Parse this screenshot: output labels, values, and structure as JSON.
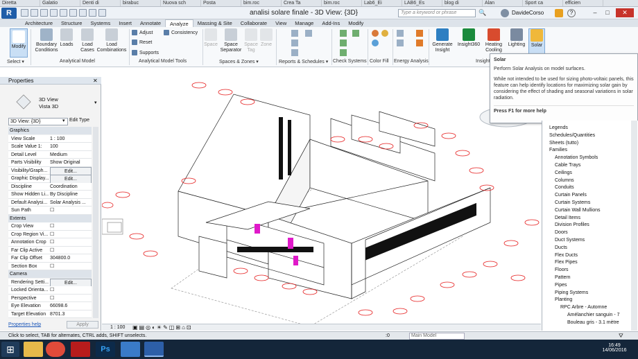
{
  "browser_tabs": [
    "Diretta",
    "Galatio",
    "Denti di",
    "birabuc",
    "Nuova sch",
    "Posta",
    "bim.roc",
    "Crea Ta",
    "bim.roc",
    "Lab6_Ei",
    "LAB6_Es",
    "blog di",
    "Alan",
    "Sport ca",
    "efficien"
  ],
  "window": {
    "title": "analisi solare finale - 3D View: {3D}",
    "search_placeholder": "Type a keyword or phrase",
    "user": "DavideCorso",
    "min": "–",
    "max": "□",
    "close": "✕"
  },
  "menu_tabs": [
    "Architecture",
    "Structure",
    "Systems",
    "Insert",
    "Annotate",
    "Analyze",
    "Massing & Site",
    "Collaborate",
    "View",
    "Manage",
    "Add-Ins",
    "Modify"
  ],
  "active_tab": "Analyze",
  "ribbon": {
    "modify": "Modify",
    "boundary_conditions": "Boundary\nConditions",
    "loads": "Loads",
    "load_cases": "Load\nCases",
    "load_combinations": "Load\nCombinations",
    "adjust": "Adjust",
    "reset": "Reset",
    "supports": "Supports",
    "consistency": "Consistency",
    "space": "Space",
    "space_separator": "Space\nSeparator",
    "space_tag": "Space\nTag",
    "zone": "Zone",
    "generate_insight": "Generate\nInsight",
    "insight360": "Insight360",
    "heating_cooling": "Heating\nCooling",
    "lighting": "Lighting",
    "solar": "Solar",
    "groups": [
      "Select ▾",
      "Analytical Model",
      "Analytical Model Tools",
      "Spaces & Zones ▾",
      "Reports & Schedules ▾",
      "Check Systems",
      "Color Fill",
      "Energy Analysis",
      "Insight"
    ]
  },
  "tooltip": {
    "title": "Solar",
    "line1": "Perform Solar Analysis on model surfaces.",
    "line2": "While not intended to be used for sizing photo-voltaic panels, this feature can help identify locations for maximizing solar gain by considering the effect of shading and seasonal variations in solar radiation.",
    "help": "Press F1 for more help"
  },
  "properties": {
    "title": "Properties",
    "type_name": "3D View",
    "type_sub": "Vista 3D",
    "selector": "3D View: {3D}",
    "edit_type": "Edit Type",
    "sections": [
      {
        "name": "Graphics",
        "rows": [
          [
            "View Scale",
            "1 : 100"
          ],
          [
            "Scale Value  1:",
            "100"
          ],
          [
            "Detail Level",
            "Medium"
          ],
          [
            "Parts Visibility",
            "Show Original"
          ],
          [
            "Visibility/Graph...",
            "Edit..."
          ],
          [
            "Graphic Display...",
            "Edit..."
          ],
          [
            "Discipline",
            "Coordination"
          ],
          [
            "Show Hidden Li...",
            "By Discipline"
          ],
          [
            "Default Analysi...",
            "Solar Analysis ..."
          ],
          [
            "Sun Path",
            "☐"
          ]
        ]
      },
      {
        "name": "Extents",
        "rows": [
          [
            "Crop View",
            "☐"
          ],
          [
            "Crop Region Vi...",
            "☐"
          ],
          [
            "Annotation Crop",
            "☐"
          ],
          [
            "Far Clip Active",
            "☐"
          ],
          [
            "Far Clip Offset",
            "304800.0"
          ],
          [
            "Section Box",
            "☐"
          ]
        ]
      },
      {
        "name": "Camera",
        "rows": [
          [
            "Rendering Setti...",
            "Edit..."
          ],
          [
            "Locked Orienta...",
            "☐"
          ],
          [
            "Perspective",
            "☐"
          ],
          [
            "Eye Elevation",
            "66098.6"
          ],
          [
            "Target Elevation",
            "8701.3"
          ]
        ]
      }
    ],
    "help_link": "Properties help",
    "apply": "Apply"
  },
  "project_browser": [
    "Legends",
    "Schedules/Quantities",
    "Sheets (tutto)",
    "Families",
    "Annotation Symbols",
    "Cable Trays",
    "Ceilings",
    "Columns",
    "Conduits",
    "Curtain Panels",
    "Curtain Systems",
    "Curtain Wall Mullions",
    "Detail Items",
    "Division Profiles",
    "Doors",
    "Duct Systems",
    "Ducts",
    "Flex Ducts",
    "Flex Pipes",
    "Floors",
    "Pattern",
    "Pipes",
    "Piping Systems",
    "Planting",
    "RPC Arbre - Automne",
    "Amélanchier sanguin - 7",
    "Bouleau gris - 3.1 mètre"
  ],
  "view_scale": "1 : 100",
  "status": {
    "hint": "Click to select, TAB for alternates, CTRL adds, SHIFT unselects.",
    "zero": ":0",
    "model": "Main Model"
  },
  "clock": {
    "time": "16:49",
    "date": "14/06/2016"
  }
}
